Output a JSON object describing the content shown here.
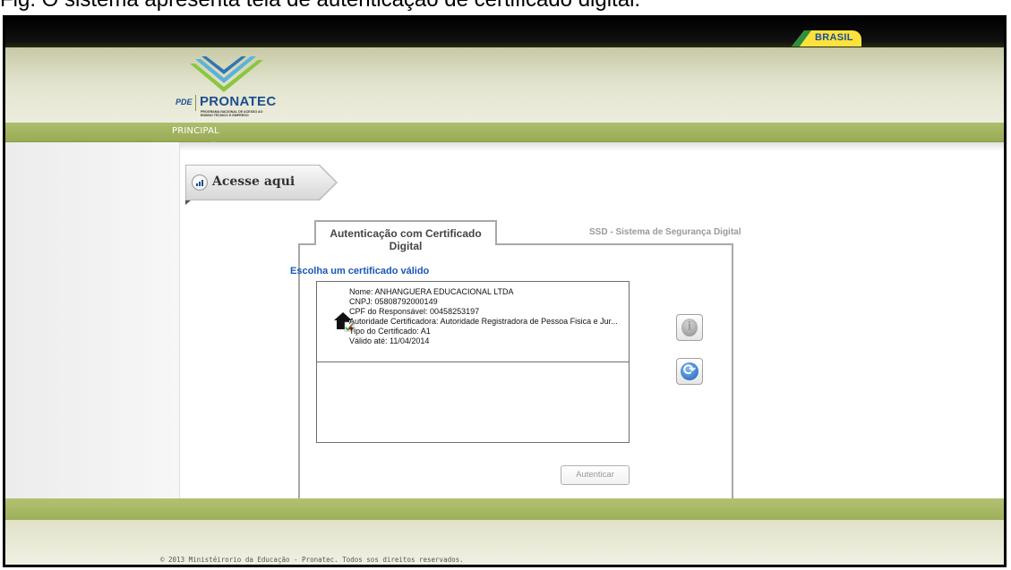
{
  "caption": "Fig. O sistema apresenta tela de autenticação de certificado digital.",
  "brand_badge": "BRASIL",
  "logo": {
    "pde": "PDE",
    "name": "PRONATEC",
    "subtitle": "PROGRAMA NACIONAL DE ACESSO AO ENSINO TÉCNICO E EMPREGO"
  },
  "nav": {
    "principal": "PRINCIPAL"
  },
  "acesse": {
    "label": "Acesse aqui",
    "icon": "bar-chart-icon"
  },
  "tabs": {
    "active": "Autenticação com Certificado Digital",
    "other": "SSD - Sistema de Segurança Digital"
  },
  "choose_label": "Escolha um certificado válido",
  "certificate": {
    "icon": "certificate-house-icon",
    "lines": [
      "Nome: ANHANGUERA EDUCACIONAL LTDA",
      "CNPJ: 05808792000149",
      "CPF do Responsável: 00458253197",
      "Autoridade Certificadora: Autoridade Registradora de Pessoa Fisica e Jur...",
      "Tipo do Certificado: A1",
      "Válido até: 11/04/2014"
    ]
  },
  "buttons": {
    "info_icon": "info-icon",
    "refresh_icon": "refresh-icon",
    "authenticate": "Autenticar"
  },
  "footer": "© 2013 Ministéirorio da Educação - Pronatec. Todos sos direitos reservados.",
  "colors": {
    "nav_green": "#98ab55",
    "link_blue": "#1a57b8",
    "brasil_yellow": "#fde23c"
  }
}
